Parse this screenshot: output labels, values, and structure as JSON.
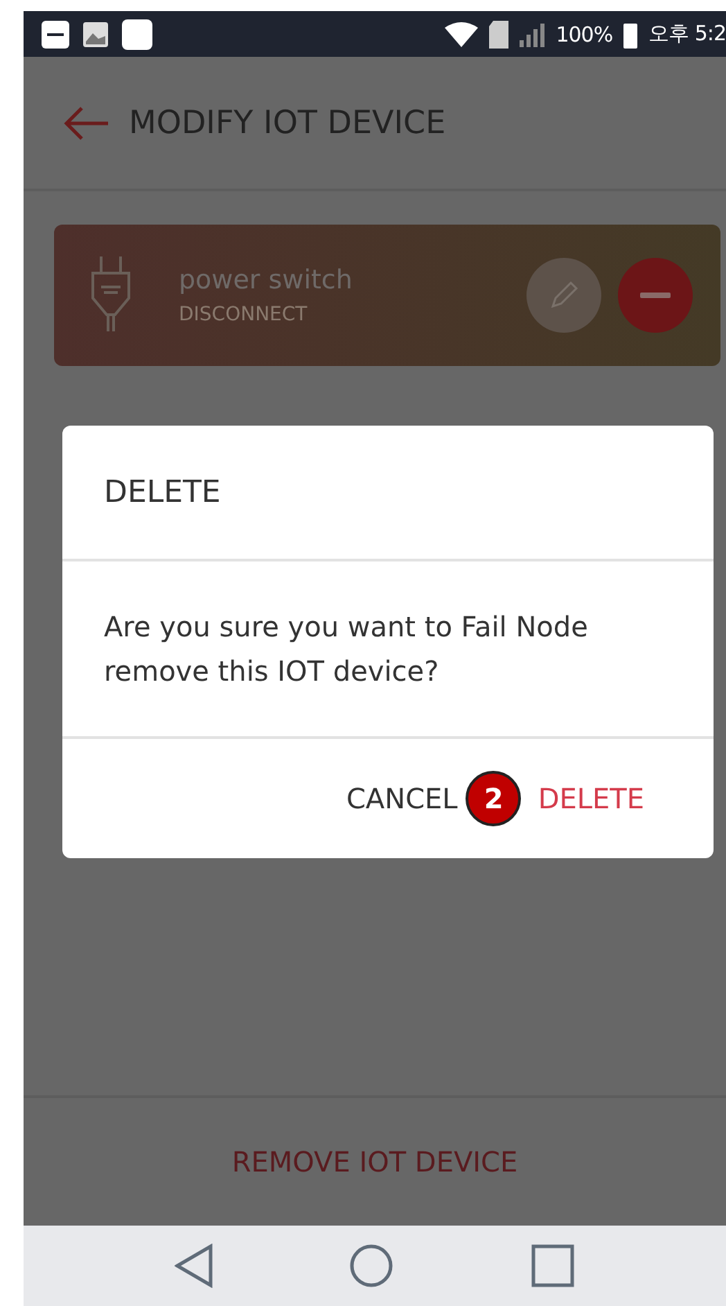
{
  "status_bar": {
    "battery": "100%",
    "time": "오후 5:2"
  },
  "app_bar": {
    "title": "MODIFY IOT DEVICE"
  },
  "devices": [
    {
      "name": "power switch",
      "status": "DISCONNECT"
    }
  ],
  "dialog": {
    "title": "DELETE",
    "message": "Are you sure you want to Fail Node remove this IOT device?",
    "buttons": [
      {
        "label": "CANCEL",
        "kind": "neutral"
      },
      {
        "label": "DELETE",
        "kind": "danger"
      }
    ],
    "marker": "2"
  },
  "footer": {
    "button": "REMOVE IOT DEVICE"
  }
}
